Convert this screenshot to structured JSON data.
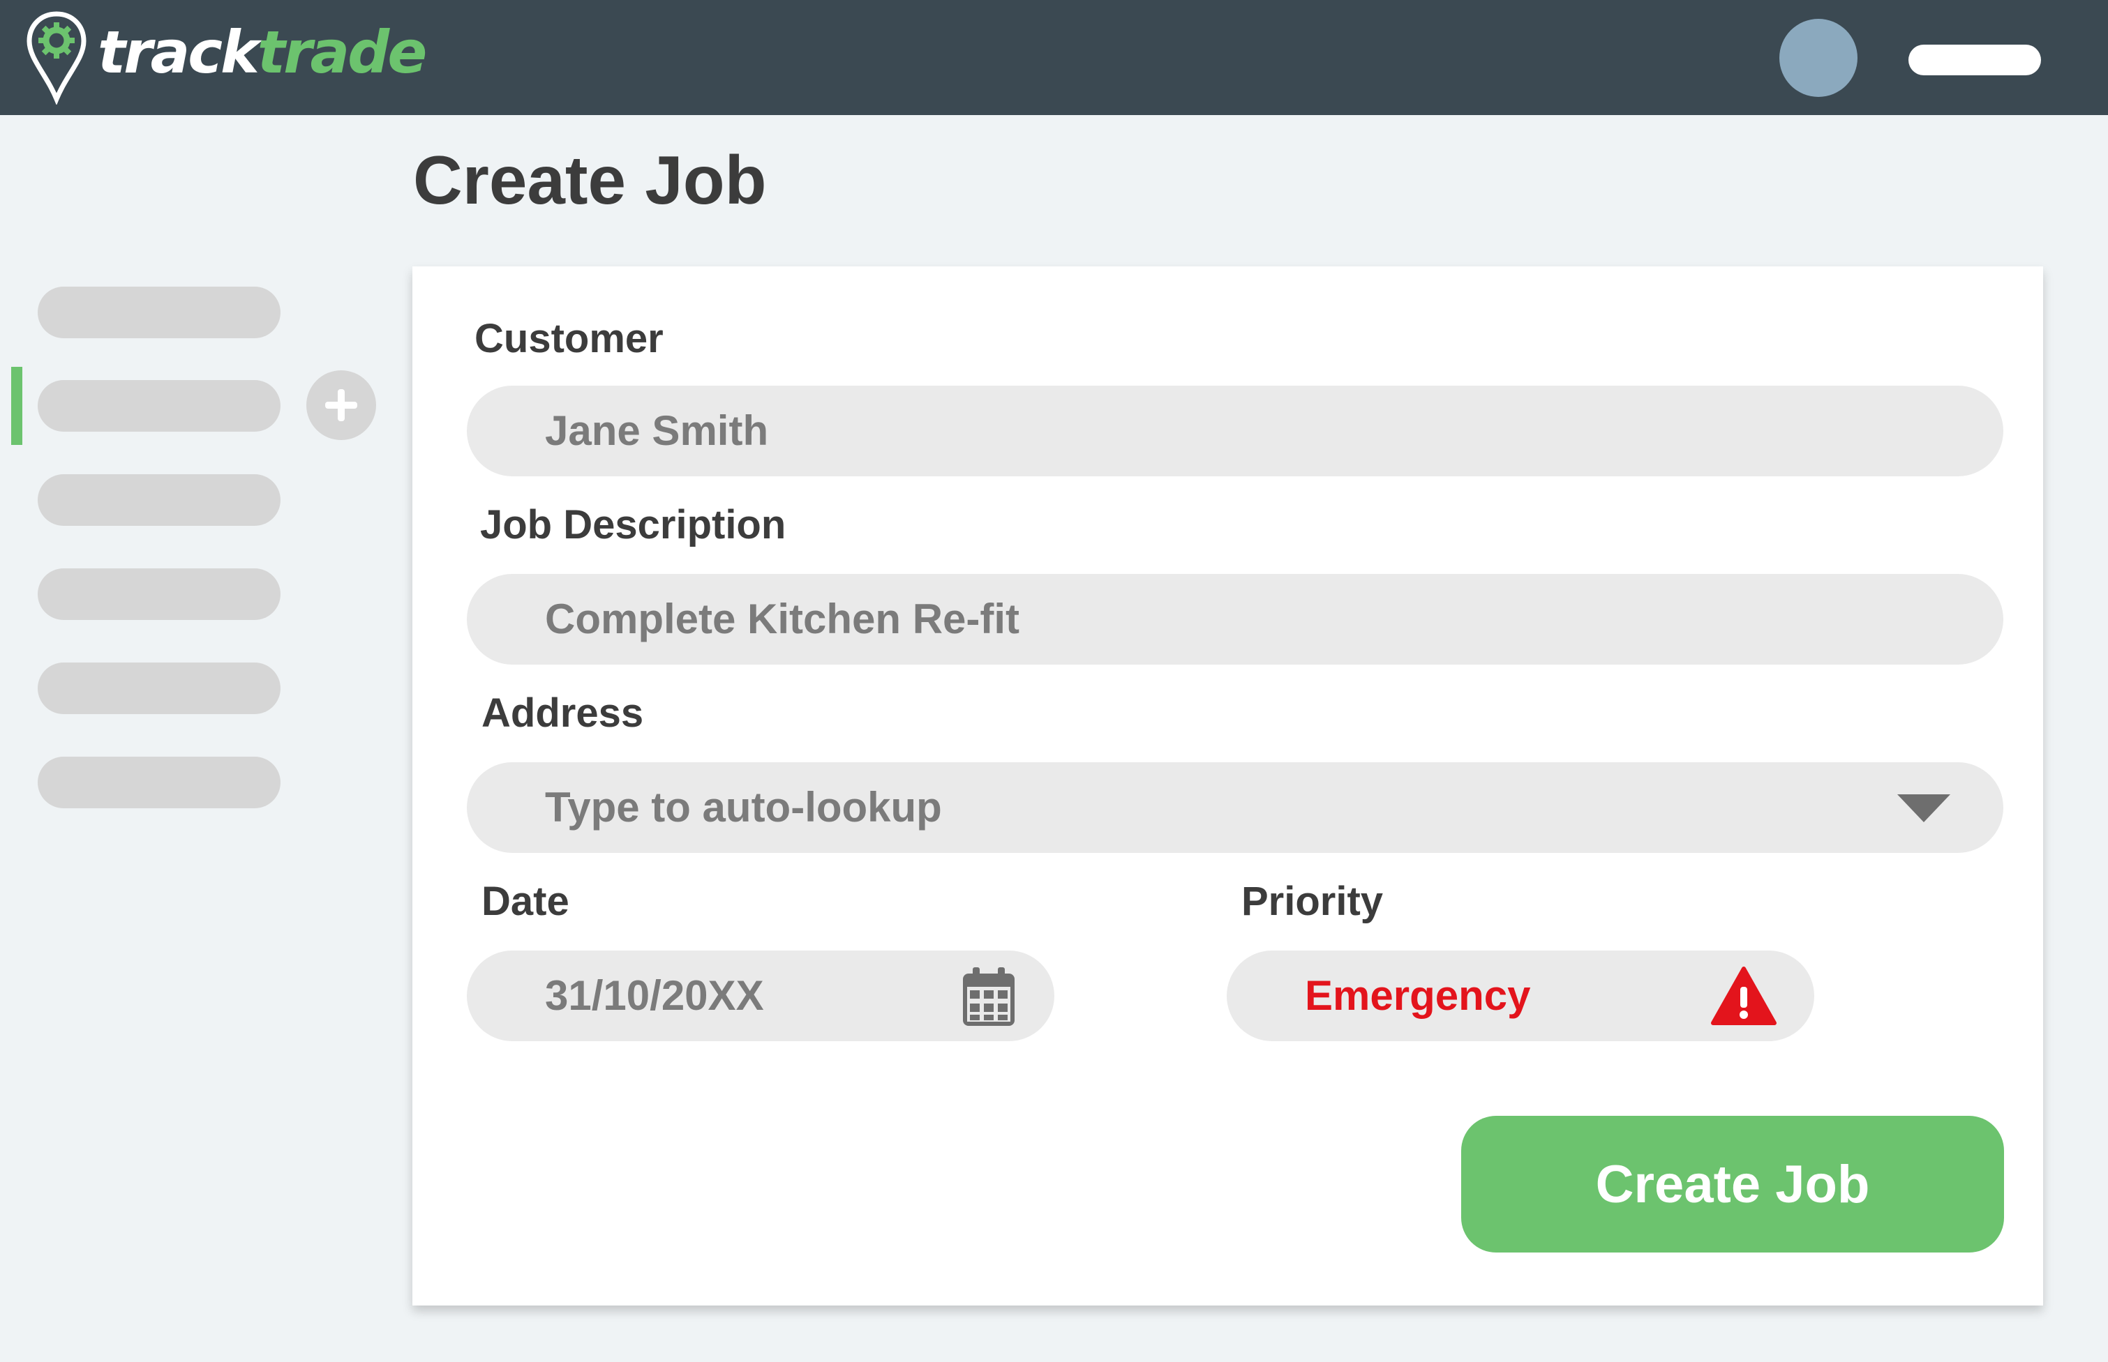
{
  "header": {
    "logo": {
      "text_part1": "track",
      "text_part2": "trade",
      "icon": "map-pin-gear-icon"
    },
    "avatar_icon": "user-avatar",
    "brand_colors": {
      "topbar": "#3b4952",
      "accent": "#6cc36e",
      "avatar": "#8ba9be"
    }
  },
  "sidebar": {
    "items": [
      {
        "label": "",
        "active": false
      },
      {
        "label": "",
        "active": true
      },
      {
        "label": "",
        "active": false
      },
      {
        "label": "",
        "active": false
      },
      {
        "label": "",
        "active": false
      },
      {
        "label": "",
        "active": false
      }
    ],
    "add_icon": "plus-icon"
  },
  "page": {
    "title": "Create Job"
  },
  "form": {
    "customer": {
      "label": "Customer",
      "value": "Jane Smith"
    },
    "description": {
      "label": "Job Description",
      "value": "Complete Kitchen Re-fit"
    },
    "address": {
      "label": "Address",
      "placeholder": "Type to auto-lookup",
      "icon": "chevron-down-icon"
    },
    "date": {
      "label": "Date",
      "value": "31/10/20XX",
      "icon": "calendar-icon"
    },
    "priority": {
      "label": "Priority",
      "value": "Emergency",
      "icon": "warning-icon",
      "color": "#e3141c"
    },
    "submit_label": "Create Job"
  }
}
